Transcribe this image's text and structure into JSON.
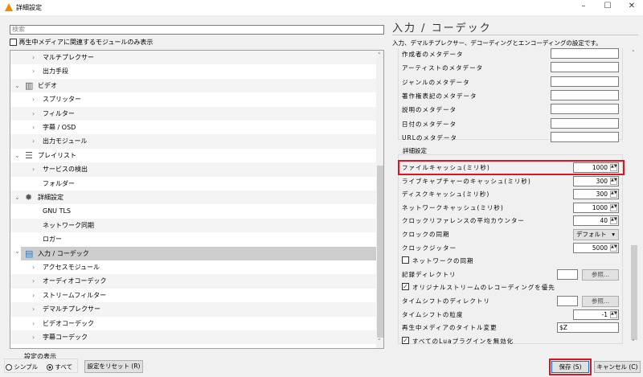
{
  "window": {
    "title": "詳細設定",
    "minimize": "–",
    "maximize": "☐",
    "close": "✕"
  },
  "left": {
    "search_placeholder": "検索",
    "only_current_label": "再生中メディアに関連するモジュールのみ表示",
    "tree": [
      {
        "label": "マルチプレクサー",
        "level": 1,
        "arrow": "›"
      },
      {
        "label": "出力手段",
        "level": 1,
        "arrow": "›"
      },
      {
        "label": "ビデオ",
        "level": 0,
        "arrow": "⌄",
        "icon": "video-icon"
      },
      {
        "label": "スプリッター",
        "level": 1,
        "arrow": "›"
      },
      {
        "label": "フィルター",
        "level": 1,
        "arrow": "›"
      },
      {
        "label": "字幕 / OSD",
        "level": 1,
        "arrow": "›"
      },
      {
        "label": "出力モジュール",
        "level": 1,
        "arrow": "›"
      },
      {
        "label": "プレイリスト",
        "level": 0,
        "arrow": "⌄",
        "icon": "playlist-icon"
      },
      {
        "label": "サービスの検出",
        "level": 1,
        "arrow": "›"
      },
      {
        "label": "フォルダー",
        "level": 1,
        "arrow": ""
      },
      {
        "label": "詳細設定",
        "level": 0,
        "arrow": "⌄",
        "icon": "gear-icon"
      },
      {
        "label": "GNU TLS",
        "level": 1,
        "arrow": ""
      },
      {
        "label": "ネットワーク同期",
        "level": 1,
        "arrow": ""
      },
      {
        "label": "ロガー",
        "level": 1,
        "arrow": ""
      },
      {
        "label": "入力 / コーデック",
        "level": 0,
        "arrow": "⌄",
        "icon": "codec-icon",
        "selected": true
      },
      {
        "label": "アクセスモジュール",
        "level": 1,
        "arrow": "›"
      },
      {
        "label": "オーディオコーデック",
        "level": 1,
        "arrow": "›"
      },
      {
        "label": "ストリームフィルター",
        "level": 1,
        "arrow": "›"
      },
      {
        "label": "デマルチプレクサー",
        "level": 1,
        "arrow": "›"
      },
      {
        "label": "ビデオコーデック",
        "level": 1,
        "arrow": "›"
      },
      {
        "label": "字幕コーデック",
        "level": 1,
        "arrow": "›"
      }
    ]
  },
  "right": {
    "title": "入力 / コーデック",
    "description": "入力、デマルチプレクサー、デコーディングとエンコーディングの設定です。",
    "metadata": [
      {
        "label": "作成者のメタデータ",
        "value": ""
      },
      {
        "label": "アーティストのメタデータ",
        "value": ""
      },
      {
        "label": "ジャンルのメタデータ",
        "value": ""
      },
      {
        "label": "著作権表記のメタデータ",
        "value": ""
      },
      {
        "label": "説明のメタデータ",
        "value": ""
      },
      {
        "label": "日付のメタデータ",
        "value": ""
      },
      {
        "label": "URLのメタデータ",
        "value": ""
      }
    ],
    "advanced_group": "詳細設定",
    "advanced": [
      {
        "type": "spin",
        "label": "ファイルキャッシュ(ミリ秒)",
        "value": "1000",
        "highlight": true
      },
      {
        "type": "spin",
        "label": "ライブキャプチャーのキャッシュ(ミリ秒)",
        "value": "300"
      },
      {
        "type": "spin",
        "label": "ディスクキャッシュ(ミリ秒)",
        "value": "300"
      },
      {
        "type": "spin",
        "label": "ネットワークキャッシュ(ミリ秒)",
        "value": "1000"
      },
      {
        "type": "spin",
        "label": "クロックリファレンスの平均カウンター",
        "value": "40"
      },
      {
        "type": "select",
        "label": "クロックの同期",
        "value": "デフォルト"
      },
      {
        "type": "spin",
        "label": "クロックジッター",
        "value": "5000"
      },
      {
        "type": "check",
        "label": "ネットワークの同期",
        "checked": false
      },
      {
        "type": "browse",
        "label": "記録ディレクトリ",
        "value": "",
        "button": "参照..."
      },
      {
        "type": "check",
        "label": "オリジナルストリームのレコーディングを優先",
        "checked": true
      },
      {
        "type": "browse",
        "label": "タイムシフトのディレクトリ",
        "value": "",
        "button": "参照..."
      },
      {
        "type": "spin",
        "label": "タイムシフトの粒度",
        "value": "-1"
      },
      {
        "type": "text",
        "label": "再生中メディアのタイトル変更",
        "value": "$Z"
      },
      {
        "type": "check",
        "label": "すべてのLuaプラグインを無効化",
        "checked": true
      }
    ]
  },
  "footer": {
    "show_settings": "設定の表示",
    "simple": "シンプル",
    "all": "すべて",
    "selected_mode": "all",
    "reset": "設定をリセット (R)",
    "save": "保存 (S)",
    "cancel": "キャンセル (C)"
  },
  "colors": {
    "highlight": "#e0141e",
    "selected_row": "#cdcdcd"
  }
}
